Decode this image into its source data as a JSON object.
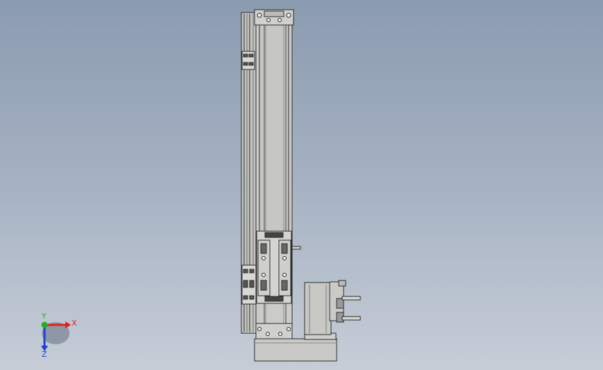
{
  "triad": {
    "x_label": "X",
    "y_label": "Y",
    "z_label": "Z",
    "x_color": "#e02020",
    "y_color": "#20b020",
    "z_color": "#2040d0"
  },
  "colors": {
    "part_fill": "#c9cac6",
    "part_dark": "#a9aaa6",
    "line": "#2b2b2b"
  }
}
